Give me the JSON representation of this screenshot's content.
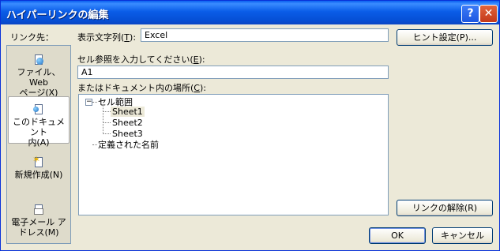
{
  "titlebar": {
    "title": "ハイパーリンクの編集",
    "help_glyph": "?",
    "close_glyph": "✕"
  },
  "link_target": {
    "label": "リンク先：",
    "items": [
      {
        "name": "link-item-web",
        "line1": "ファイル、Web",
        "line2": "ページ(X)",
        "icon": "web-page-icon"
      },
      {
        "name": "link-item-this-doc",
        "line1": "このドキュメント",
        "line2": "内(A)",
        "icon": "document-icon",
        "selected": true
      },
      {
        "name": "link-item-new",
        "line1": "新規作成(N)",
        "line2": "",
        "icon": "new-document-icon"
      },
      {
        "name": "link-item-email",
        "line1": "電子メール ア",
        "line2": "ドレス(M)",
        "icon": "email-icon"
      }
    ]
  },
  "display_text": {
    "label_prefix": "表示文字列(",
    "label_key": "T",
    "label_suffix": "):",
    "value": "Excel"
  },
  "screen_tip_button": "ヒント設定(P)...",
  "cell_ref": {
    "label_prefix": "セル参照を入力してください(",
    "label_key": "E",
    "label_suffix": "):",
    "value": "A1"
  },
  "place_in_doc": {
    "label_prefix": "またはドキュメント内の場所(",
    "label_key": "C",
    "label_suffix": "):",
    "tree": {
      "root": "セル範囲",
      "root_expander": "−",
      "children": [
        "Sheet1",
        "Sheet2",
        "Sheet3"
      ],
      "selected": "Sheet1",
      "second_root": "定義された名前"
    }
  },
  "remove_link_button": "リンクの解除(R)",
  "ok_button": "OK",
  "cancel_button": "キャンセル",
  "colors": {
    "title_bar": "#0a5de8",
    "dialog_bg": "#ece9d8",
    "field_border": "#7f9db9"
  }
}
